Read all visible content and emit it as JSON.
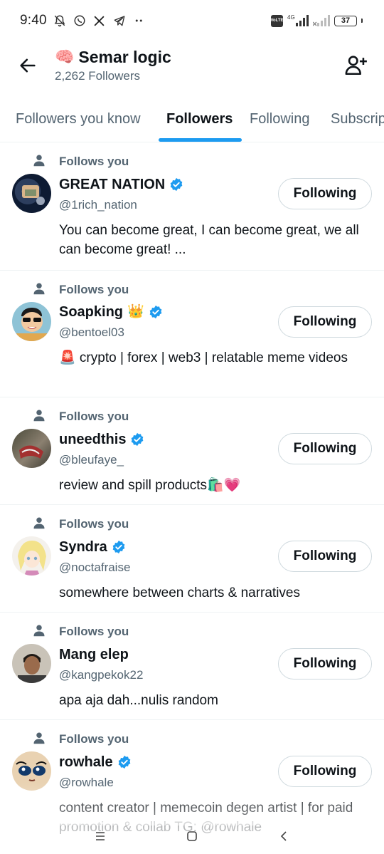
{
  "status_bar": {
    "time": "9:40",
    "battery": "37",
    "network": "4G",
    "lte": "Vo LTE"
  },
  "header": {
    "title": "Semar logic",
    "title_emoji": "🧠",
    "followers_count": "2,262 Followers"
  },
  "tabs": [
    {
      "label": "Followers you know",
      "active": false
    },
    {
      "label": "Followers",
      "active": true
    },
    {
      "label": "Following",
      "active": false
    },
    {
      "label": "Subscriptions",
      "active": false
    }
  ],
  "follows_you_label": "Follows you",
  "follow_button_label": "Following",
  "users": [
    {
      "name": "GREAT NATION",
      "verified": true,
      "handle": "@1rich_nation",
      "bio": "You can become great, I can become great, we all can become great! ...",
      "extra": ""
    },
    {
      "name": "Soapking",
      "verified": true,
      "handle": "@bentoel03",
      "bio": "🚨 crypto | forex | web3 | relatable meme videos",
      "extra": "👑"
    },
    {
      "name": "uneedthis",
      "verified": true,
      "handle": "@bleufaye_",
      "bio": "review and spill products🛍️💗",
      "extra": ""
    },
    {
      "name": "Syndra",
      "verified": true,
      "handle": "@noctafraise",
      "bio": "somewhere between charts & narratives",
      "extra": ""
    },
    {
      "name": "Mang elep",
      "verified": false,
      "handle": "@kangpekok22",
      "bio": "apa aja dah...nulis random",
      "extra": ""
    },
    {
      "name": "rowhale",
      "verified": true,
      "handle": "@rowhale",
      "bio": "content creator | memecoin degen artist | for paid promotion & collab TG: @rowhale",
      "extra": ""
    }
  ],
  "colors": {
    "accent": "#1d9bf0",
    "text": "#0f1419",
    "muted": "#536471",
    "border": "#cfd9de"
  }
}
